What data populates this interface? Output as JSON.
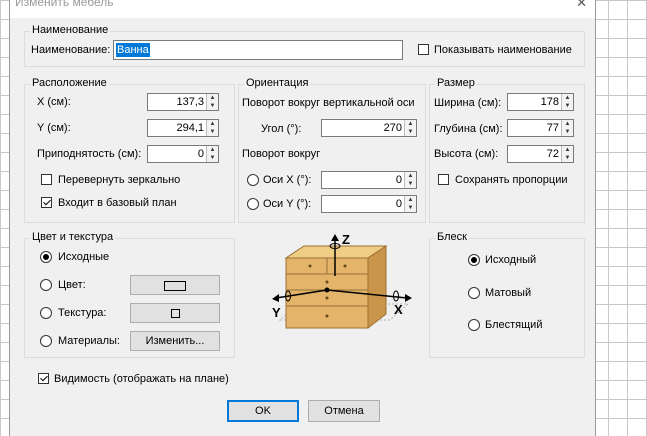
{
  "window": {
    "title": "Изменить мебель"
  },
  "name_section": {
    "group_label": "Наименование",
    "label": "Наименование:",
    "value": "Ванна",
    "show_name_label": "Показывать наименование"
  },
  "location": {
    "group_label": "Расположение",
    "x_label": "X (см):",
    "x_value": "137,3",
    "y_label": "Y (см):",
    "y_value": "294,1",
    "elevation_label": "Приподнятость (см):",
    "elevation_value": "0",
    "mirror_label": "Перевернуть зеркально",
    "base_plan_label": "Входит в базовый план"
  },
  "orientation": {
    "group_label": "Ориентация",
    "vertical_axis_label": "Поворот вокруг вертикальной оси",
    "angle_label": "Угол (°):",
    "angle_value": "270",
    "rotate_around_label": "Поворот вокруг",
    "axis_x_label": "Оси X (°):",
    "axis_x_value": "0",
    "axis_y_label": "Оси Y (°):",
    "axis_y_value": "0",
    "axis_z_glyph": "Z",
    "axis_x_glyph": "X",
    "axis_y_glyph": "Y"
  },
  "size": {
    "group_label": "Размер",
    "width_label": "Ширина (см):",
    "width_value": "178",
    "depth_label": "Глубина (см):",
    "depth_value": "77",
    "height_label": "Высота (см):",
    "height_value": "72",
    "keep_proportions_label": "Сохранять пропорции"
  },
  "color_texture": {
    "group_label": "Цвет и текстура",
    "default_label": "Исходные",
    "color_label": "Цвет:",
    "texture_label": "Текстура:",
    "materials_label": "Материалы:",
    "change_button": "Изменить..."
  },
  "shininess": {
    "group_label": "Блеск",
    "default_label": "Исходный",
    "matte_label": "Матовый",
    "shiny_label": "Блестящий"
  },
  "visibility_label": "Видимость (отображать на плане)",
  "buttons": {
    "ok": "OK",
    "cancel": "Отмена"
  },
  "close_glyph": "✕",
  "colors": {
    "selection": "#0078d7",
    "furniture": "#e3b46a",
    "dialog_bg": "#f0f0f0"
  }
}
